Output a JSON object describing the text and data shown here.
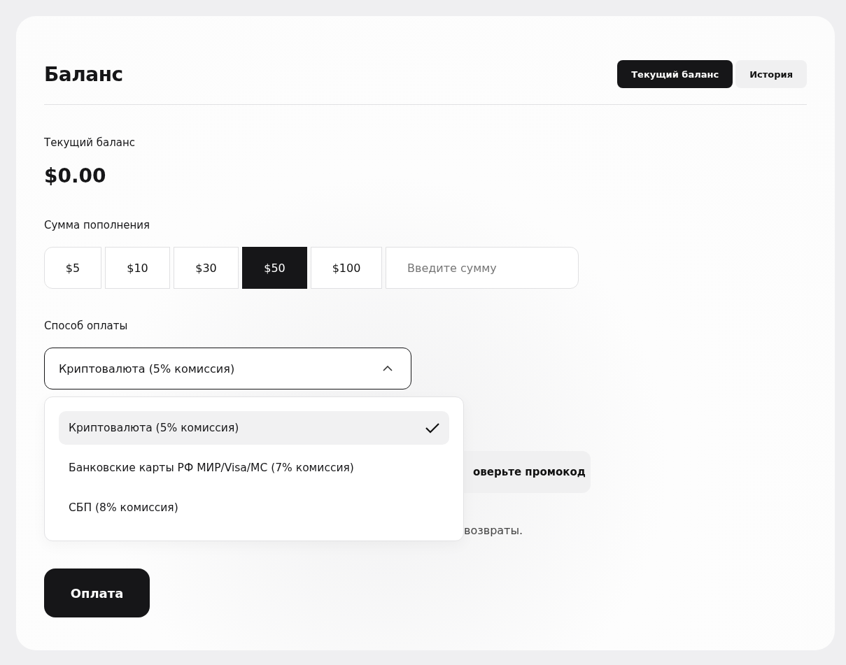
{
  "title": "Баланс",
  "tabs": [
    {
      "label": "Текущий баланс",
      "selected": true
    },
    {
      "label": "История",
      "selected": false
    }
  ],
  "balance": {
    "label": "Текущий баланс",
    "value": "$0.00"
  },
  "amount": {
    "label": "Сумма пополнения",
    "options": [
      {
        "label": "$5",
        "selected": false
      },
      {
        "label": "$10",
        "selected": false
      },
      {
        "label": "$30",
        "selected": false
      },
      {
        "label": "$50",
        "selected": true
      },
      {
        "label": "$100",
        "selected": false
      }
    ],
    "custom": {
      "placeholder": "Введите сумму"
    }
  },
  "payment": {
    "label": "Способ оплаты",
    "value": "Криптовалюта (5% комиссия)",
    "expanded": true,
    "options": [
      {
        "label": "Криптовалюта (5% комиссия)",
        "selected": true
      },
      {
        "label": "Банковские карты РФ МИР/Visa/MC (7% комиссия)",
        "selected": false
      },
      {
        "label": "СБП (8% комиссия)",
        "selected": false
      }
    ]
  },
  "promo_button": "оверьте промокод",
  "agreement_tail": "возвраты.",
  "pay_button": "Оплата"
}
